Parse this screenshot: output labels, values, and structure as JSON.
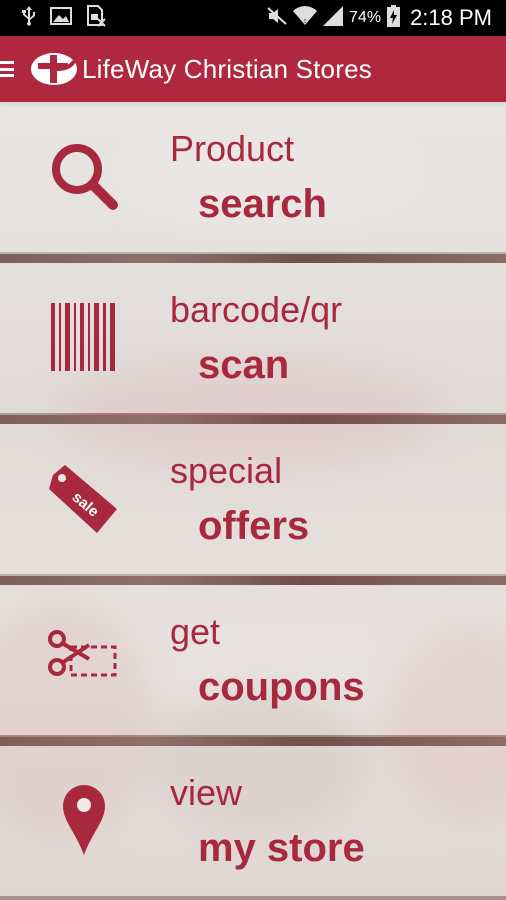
{
  "status_bar": {
    "left_icons": [
      "usb-icon",
      "image-icon",
      "sim-icon"
    ],
    "right_icons": [
      "mute-icon",
      "wifi-icon",
      "signal-icon",
      "battery-icon"
    ],
    "battery_percent": "74%",
    "time": "2:18 PM"
  },
  "app_bar": {
    "title": "LifeWay Christian Stores",
    "brand_color": "#b0283f"
  },
  "menu": [
    {
      "line1": "Product",
      "line2": "search",
      "icon": "search-icon"
    },
    {
      "line1": "barcode/qr",
      "line2": "scan",
      "icon": "barcode-icon"
    },
    {
      "line1": "special",
      "line2": "offers",
      "icon": "sale-tag-icon",
      "icon_text": "sale"
    },
    {
      "line1": "get",
      "line2": "coupons",
      "icon": "scissors-coupon-icon"
    },
    {
      "line1": "view",
      "line2": "my store",
      "icon": "map-pin-icon"
    }
  ],
  "colors": {
    "accent": "#a8283e",
    "status_bar": "#000000"
  }
}
